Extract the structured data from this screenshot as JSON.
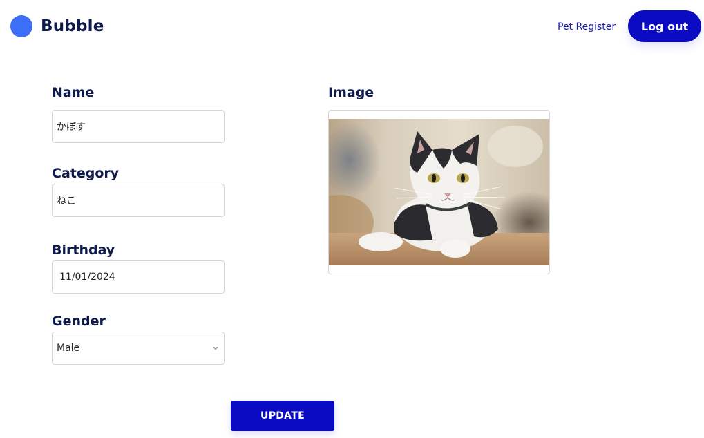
{
  "header": {
    "brand": "Bubble",
    "nav_link": "Pet Register",
    "logout_label": "Log out"
  },
  "form": {
    "name": {
      "label": "Name",
      "value": "かぼす"
    },
    "category": {
      "label": "Category",
      "value": "ねこ"
    },
    "birthday": {
      "label": "Birthday",
      "value": "11/01/2024"
    },
    "gender": {
      "label": "Gender",
      "value": "Male"
    },
    "image": {
      "label": "Image"
    },
    "submit_label": "UPDATE"
  },
  "colors": {
    "accent": "#0b0bc4",
    "logo": "#3c6ef8",
    "heading": "#0f1b4c"
  },
  "icons": {
    "logo": "circle-logo-icon",
    "select_arrow": "chevron-down-icon"
  }
}
